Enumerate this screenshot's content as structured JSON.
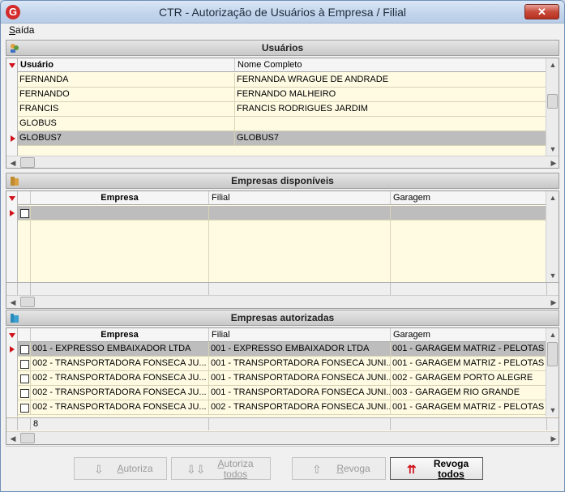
{
  "window": {
    "title": "CTR -  Autorização de Usuários à Empresa / Filial",
    "close_glyph": "✕",
    "app_icon_letter": "G"
  },
  "menu": {
    "items": [
      {
        "label_accel": "S",
        "label_rest": "aída"
      }
    ]
  },
  "usuarios": {
    "header": "Usuários",
    "columns": [
      "Usuário",
      "Nome Completo"
    ],
    "rows": [
      {
        "usuario": "FERNANDA",
        "nome": "FERNANDA WRAGUE DE ANDRADE"
      },
      {
        "usuario": "FERNANDO",
        "nome": "FERNANDO MALHEIRO"
      },
      {
        "usuario": "FRANCIS",
        "nome": "FRANCIS RODRIGUES JARDIM"
      },
      {
        "usuario": "GLOBUS",
        "nome": ""
      },
      {
        "usuario": "GLOBUS7",
        "nome": "GLOBUS7"
      }
    ],
    "selected_index": 4
  },
  "disponiveis": {
    "header": "Empresas disponíveis",
    "columns": [
      "Empresa",
      "Filial",
      "Garagem"
    ]
  },
  "autorizadas": {
    "header": "Empresas autorizadas",
    "columns": [
      "Empresa",
      "Filial",
      "Garagem"
    ],
    "rows": [
      {
        "empresa": "001 - EXPRESSO EMBAIXADOR LTDA",
        "filial": "001 - EXPRESSO EMBAIXADOR LTDA",
        "garagem": "001 - GARAGEM MATRIZ - PELOTAS"
      },
      {
        "empresa": "002 - TRANSPORTADORA FONSECA JU...",
        "filial": "001 - TRANSPORTADORA FONSECA JUNI...",
        "garagem": "001 - GARAGEM MATRIZ - PELOTAS"
      },
      {
        "empresa": "002 - TRANSPORTADORA FONSECA JU...",
        "filial": "001 - TRANSPORTADORA FONSECA JUNI...",
        "garagem": "002 - GARAGEM PORTO ALEGRE"
      },
      {
        "empresa": "002 - TRANSPORTADORA FONSECA JU...",
        "filial": "001 - TRANSPORTADORA FONSECA JUNI...",
        "garagem": "003 - GARAGEM RIO GRANDE"
      },
      {
        "empresa": "002 - TRANSPORTADORA FONSECA JU...",
        "filial": "002 - TRANSPORTADORA FONSECA JUNI...",
        "garagem": "001 - GARAGEM MATRIZ - PELOTAS"
      }
    ],
    "count": "8"
  },
  "buttons": {
    "autoriza": {
      "accel": "A",
      "rest": "utoriza"
    },
    "autoriza_todos": {
      "accel": "A",
      "rest": "utoriza",
      "line2": "todos"
    },
    "revoga": {
      "accel": "R",
      "rest": "evoga"
    },
    "revoga_todos": {
      "line1": "Revoga",
      "line2": "todos"
    }
  },
  "colors": {
    "grid_bg": "#fffbe3",
    "selection": "#bdbdbd",
    "indicator": "#d0121b"
  }
}
